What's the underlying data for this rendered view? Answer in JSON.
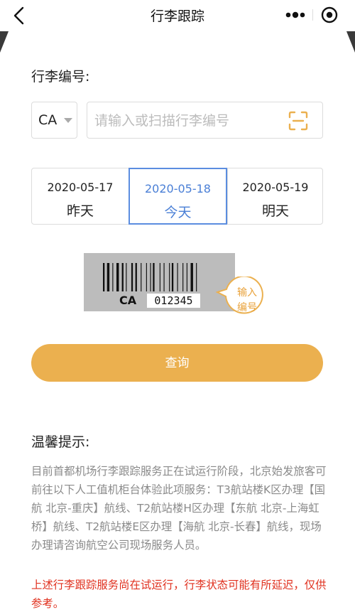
{
  "nav": {
    "title": "行李跟踪"
  },
  "form": {
    "section_label": "行李编号:",
    "airline_selected": "CA",
    "tag_placeholder": "请输入或扫描行李编号"
  },
  "dates": [
    {
      "date": "2020-05-17",
      "label": "昨天"
    },
    {
      "date": "2020-05-18",
      "label": "今天"
    },
    {
      "date": "2020-05-19",
      "label": "明天"
    }
  ],
  "sample_tag": {
    "prefix": "CA",
    "number": "012345",
    "hint_line1": "输入",
    "hint_line2": "编号"
  },
  "query_button": "查询",
  "tips": {
    "title": "温馨提示:",
    "body": "目前首都机场行李跟踪服务正在试运行阶段，北京始发旅客可前往以下人工值机柜台体验此项服务：T3航站楼K区办理【国航 北京-重庆】航线、T2航站楼H区办理【东航 北京-上海虹桥】航线、T2航站楼E区办理【海航 北京-长春】航线，现场办理请咨询航空公司现场服务人员。",
    "warning": "上述行李跟踪服务尚在试运行，行李状态可能有所延迟，仅供参考。"
  },
  "colors": {
    "accent_orange": "#ebb04f",
    "selected_blue": "#4a7fd6",
    "warning_red": "#e0301e",
    "hint_gray": "#8a8a8a"
  }
}
